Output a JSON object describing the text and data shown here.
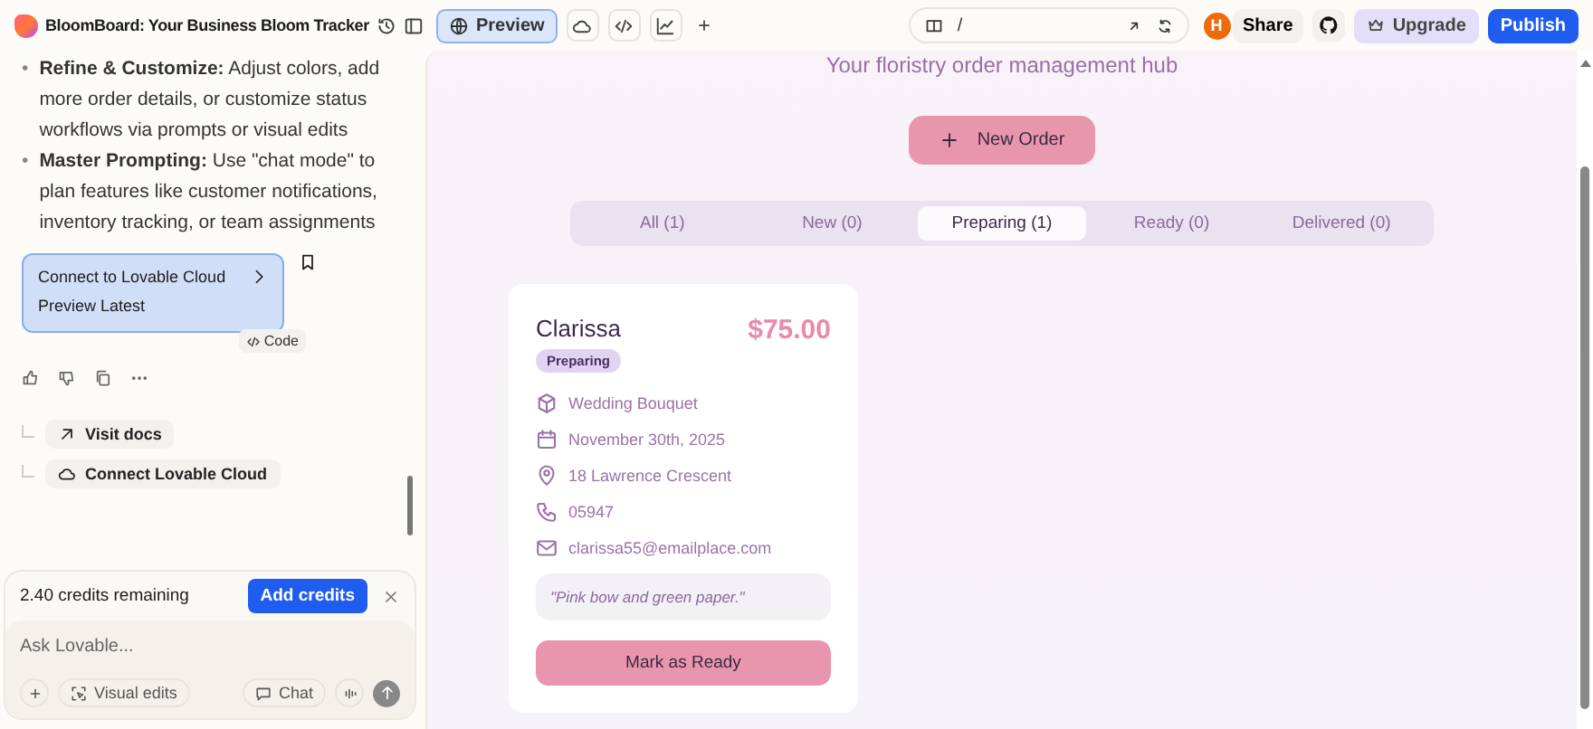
{
  "header": {
    "project_title": "BloomBoard: Your Business Bloom Tracker",
    "preview_label": "Preview",
    "preview_selected": true,
    "url_path": "/",
    "avatar_initial": "H",
    "share": "Share",
    "upgrade": "Upgrade",
    "publish": "Publish"
  },
  "chat": {
    "bullets": [
      {
        "bullet": "•",
        "text": "**Refine & Customize:** Adjust colors, add more order details, or customize status workflows via prompts or visual edits"
      },
      {
        "bullet": "•",
        "text": "**Master Prompting:** Use \"chat mode\" to plan features like customer notifications, inventory tracking, or team assignments"
      }
    ],
    "version_card": {
      "title": "Connect to Lovable Cloud",
      "subtitle": "Preview Latest",
      "code_label": "Code"
    },
    "suggestions": [
      {
        "kind": "link",
        "label": "Visit docs"
      },
      {
        "kind": "cloud",
        "label": "Connect Lovable Cloud"
      }
    ],
    "credits": {
      "text": "2.40 credits remaining",
      "button": "Add credits"
    },
    "input": {
      "placeholder": "Ask Lovable...",
      "visual_edits": "Visual edits",
      "chat": "Chat"
    }
  },
  "app": {
    "subtitle": "Your floristry order management hub",
    "new_order": "New Order",
    "tabs": [
      {
        "label": "All (1)",
        "selected": false
      },
      {
        "label": "New (0)",
        "selected": false
      },
      {
        "label": "Preparing (1)",
        "selected": true
      },
      {
        "label": "Ready (0)",
        "selected": false
      },
      {
        "label": "Delivered (0)",
        "selected": false
      }
    ],
    "orders": [
      {
        "customer": "Clarissa",
        "price": "$75.00",
        "status": "Preparing",
        "details": [
          {
            "kind": "product",
            "text": "Wedding Bouquet"
          },
          {
            "kind": "date",
            "text": "November 30th, 2025"
          },
          {
            "kind": "address",
            "text": "18 Lawrence Crescent"
          },
          {
            "kind": "phone",
            "text": "05947"
          },
          {
            "kind": "email",
            "text": "clarissa55@emailplace.com"
          }
        ],
        "note": "\"Pink bow and green paper.\"",
        "action": "Mark as Ready"
      }
    ]
  }
}
